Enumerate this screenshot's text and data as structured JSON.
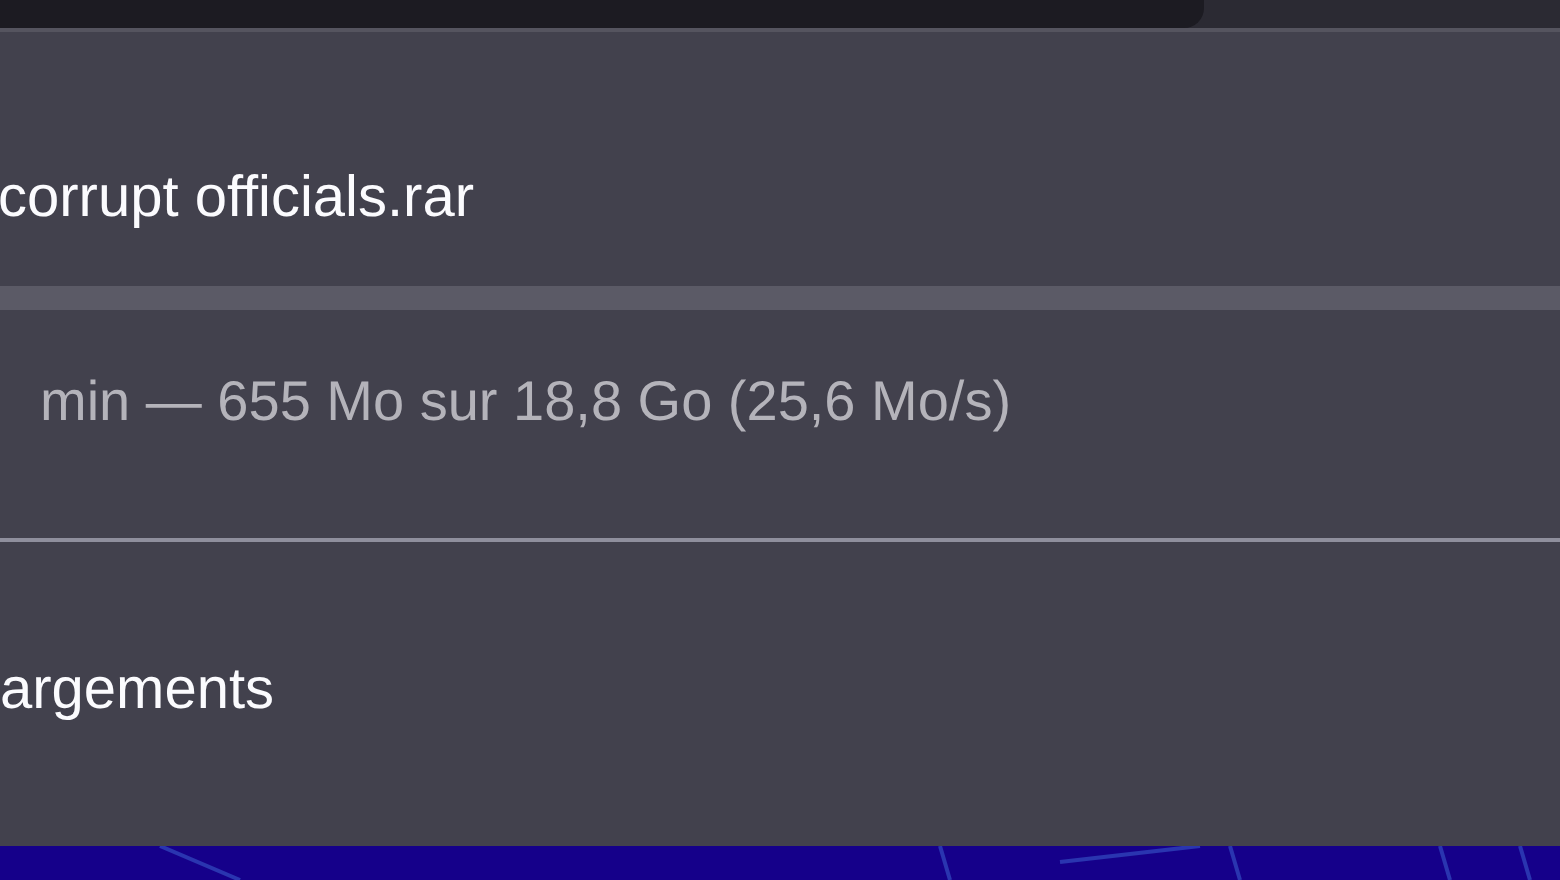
{
  "download": {
    "filename": "corrupt officials.rar",
    "status": "min — 655 Mo sur 18,8 Go (25,6 Mo/s)"
  },
  "footer_link": "argements"
}
